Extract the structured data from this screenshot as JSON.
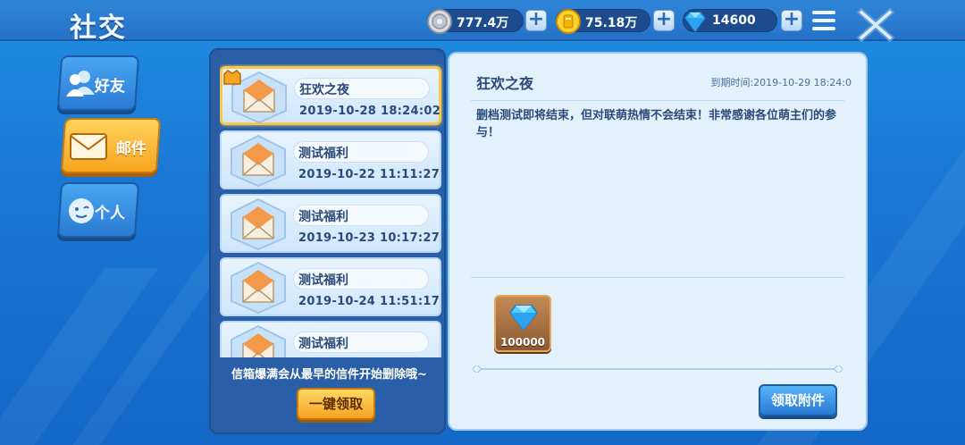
{
  "header": {
    "title": "社交",
    "currencies": [
      {
        "icon": "silver-coin-icon",
        "value": "777.4万"
      },
      {
        "icon": "gold-coin-icon",
        "value": "75.18万"
      },
      {
        "icon": "diamond-icon",
        "value": "14600"
      }
    ]
  },
  "sidebar": {
    "tabs": [
      {
        "label": "好友",
        "icon": "friends-icon",
        "active": false
      },
      {
        "label": "邮件",
        "icon": "mail-icon",
        "active": true
      },
      {
        "label": "个人",
        "icon": "profile-icon",
        "active": false
      }
    ]
  },
  "mail_list": {
    "items": [
      {
        "subject": "狂欢之夜",
        "date": "2019-10-28 18:24:02",
        "selected": true
      },
      {
        "subject": "测试福利",
        "date": "2019-10-22 11:11:27",
        "selected": false
      },
      {
        "subject": "测试福利",
        "date": "2019-10-23 10:17:27",
        "selected": false
      },
      {
        "subject": "测试福利",
        "date": "2019-10-24 11:51:17",
        "selected": false
      },
      {
        "subject": "测试福利",
        "date": "",
        "selected": false
      }
    ],
    "hint": "信箱爆满会从最早的信件开始删除哦~",
    "claim_all_label": "一键领取"
  },
  "detail": {
    "title": "狂欢之夜",
    "expire": "到期时间:2019-10-29 18:24:0",
    "body": "删档测试即将结束，但对联萌热情不会结束！非常感谢各位萌主们的参与！",
    "attachments": [
      {
        "icon": "diamond-icon",
        "quantity": "100000"
      }
    ],
    "claim_label": "领取附件"
  },
  "colors": {
    "accent_orange": "#f7a323",
    "accent_blue": "#2a7ad4",
    "selected_border": "#f6c94a"
  }
}
